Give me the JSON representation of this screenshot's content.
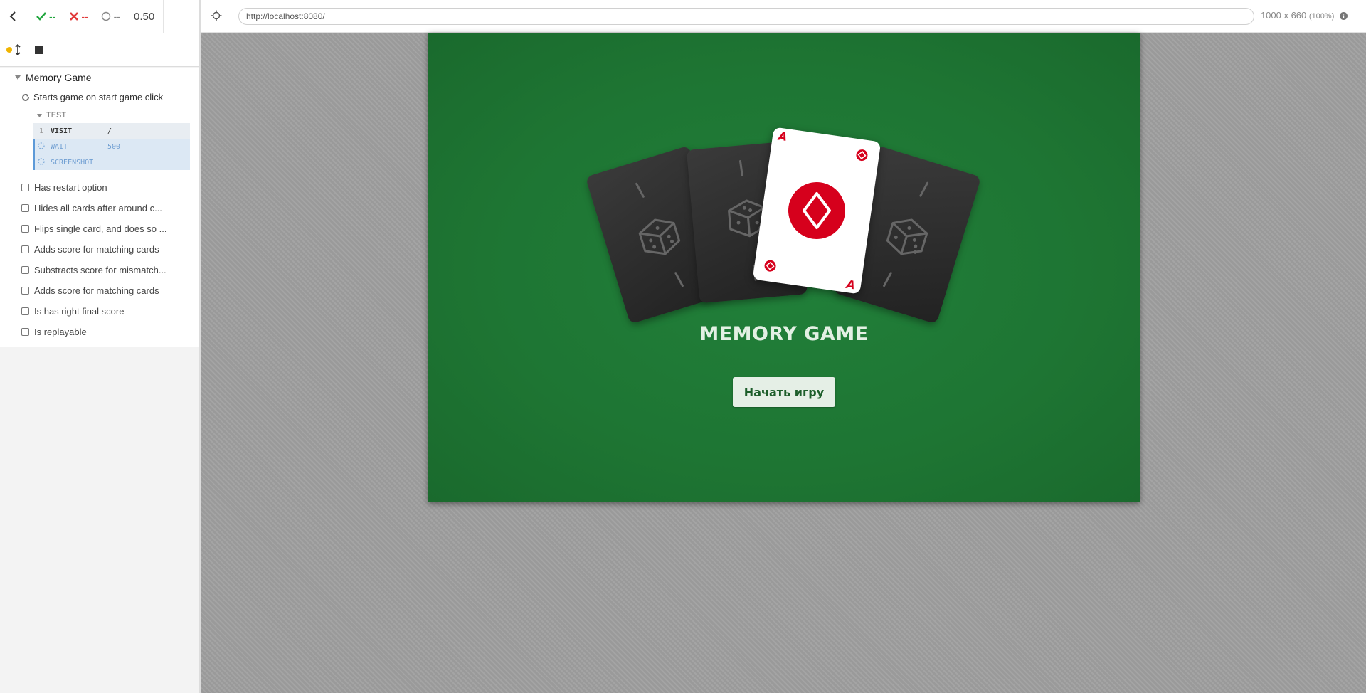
{
  "stats": {
    "passed": "--",
    "failed": "--",
    "pending": "--",
    "duration": "0.50"
  },
  "suite": {
    "title": "Memory Game",
    "running_test": "Starts game on start game click",
    "command_section": "TEST",
    "commands": [
      {
        "num": "1",
        "name": "VISIT",
        "arg": "/"
      },
      {
        "num": "",
        "name": "WAIT",
        "arg": "500"
      },
      {
        "num": "",
        "name": "SCREENSHOT",
        "arg": ""
      }
    ],
    "tests": [
      "Has restart option",
      "Hides all cards after around c...",
      "Flips single card, and does so ...",
      "Adds score for matching cards",
      "Substracts score for mismatch...",
      "Adds score for matching cards",
      "Is has right final score",
      "Is replayable"
    ]
  },
  "browser": {
    "url": "http://localhost:8080/",
    "viewport": "1000 x 660",
    "zoom": "(100%)"
  },
  "app": {
    "title": "MEMORY GAME",
    "start_button": "Начать игру",
    "card_rank": "A",
    "card_suit": "diamonds"
  },
  "colors": {
    "table_green": "#1e7533",
    "card_red": "#d6001c",
    "pass_green": "#20a63d",
    "fail_red": "#e23a3a",
    "running_orange": "#f0b400"
  }
}
